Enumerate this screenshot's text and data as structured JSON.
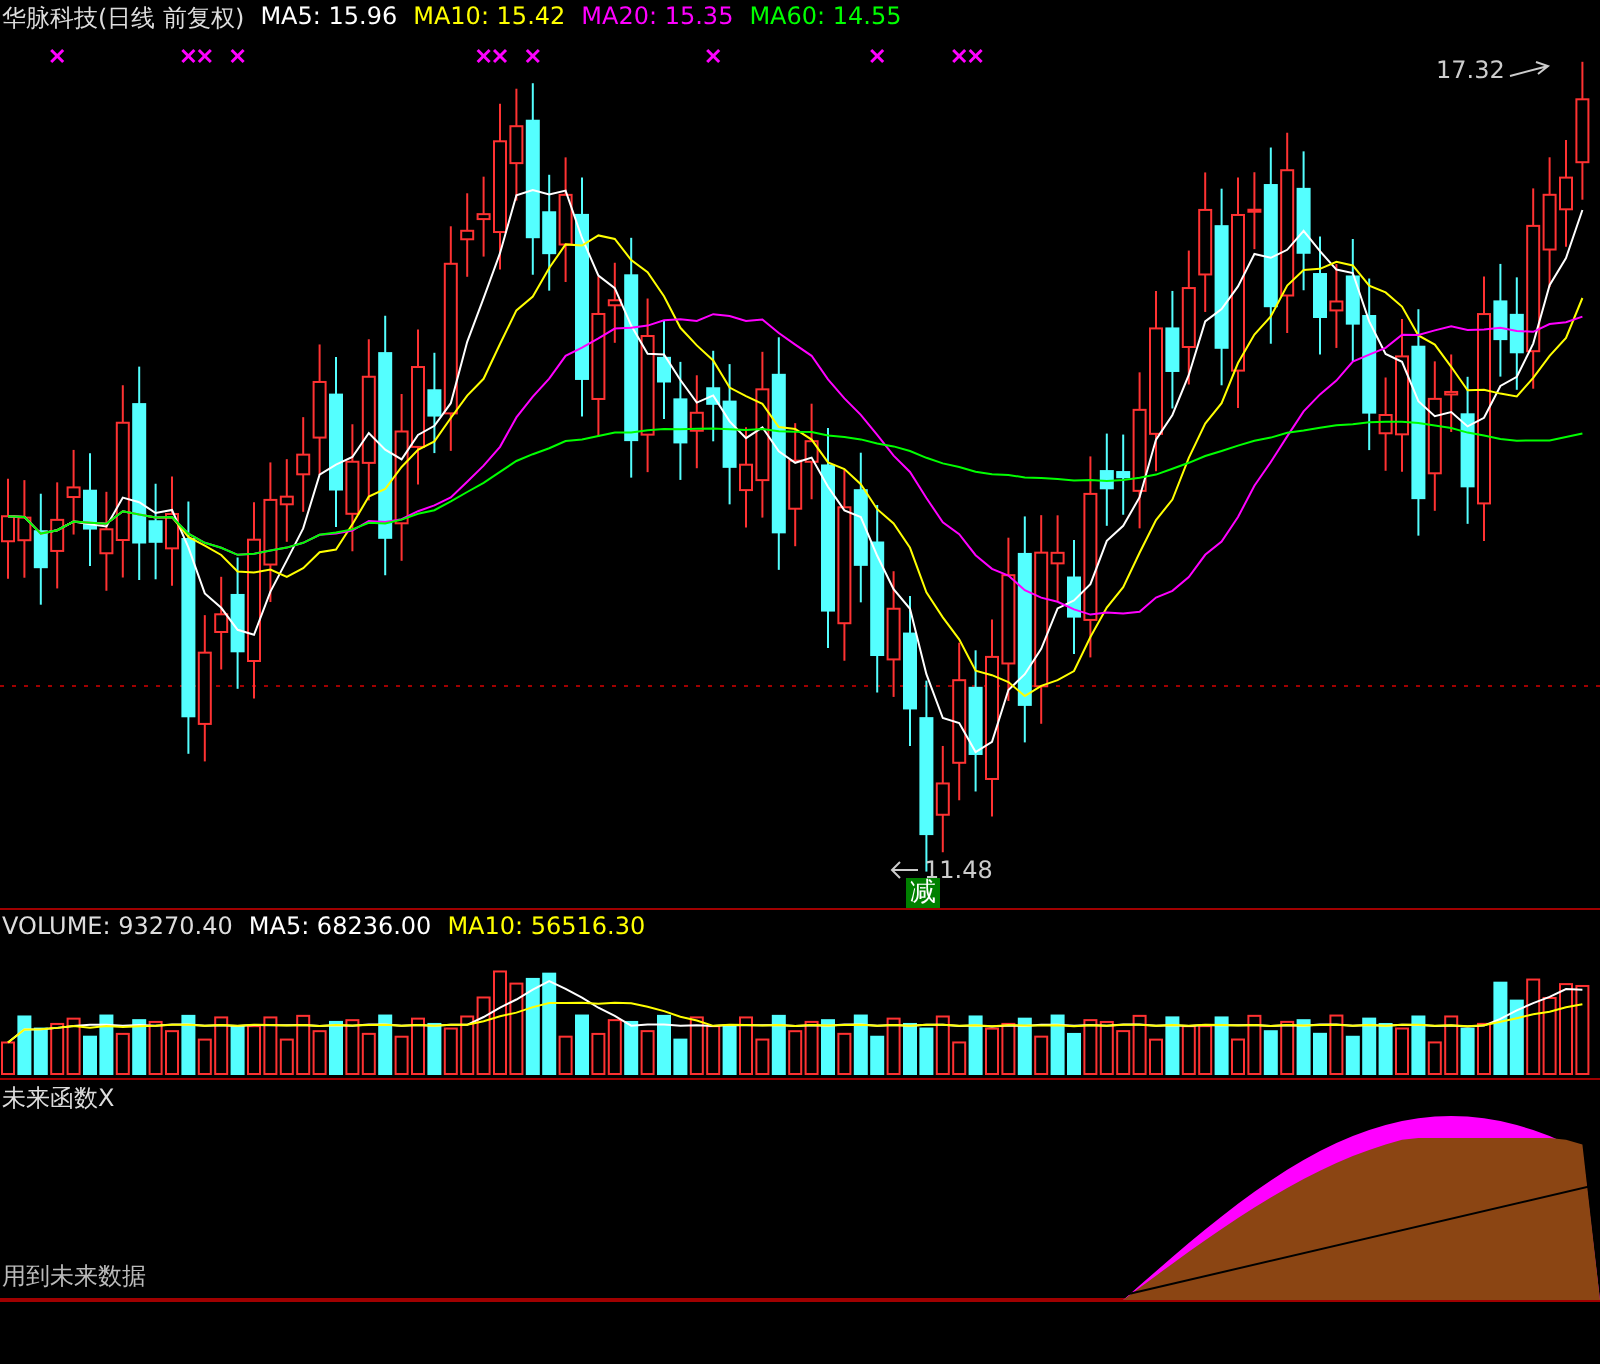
{
  "main": {
    "title": "华脉科技(日线 前复权)",
    "indicators": [
      {
        "label": "MA5:",
        "value": "15.96",
        "color": "#ffffff"
      },
      {
        "label": "MA10:",
        "value": "15.42",
        "color": "#ffff00"
      },
      {
        "label": "MA20:",
        "value": "15.35",
        "color": "#ff00ff"
      },
      {
        "label": "MA60:",
        "value": "14.55",
        "color": "#00ff00"
      }
    ],
    "high_label": "17.32",
    "low_label": "11.48",
    "signal_badge": "减"
  },
  "volume": {
    "title": "VOLUME:",
    "value": "93270.40",
    "indicators": [
      {
        "label": "MA5:",
        "value": "68236.00",
        "color": "#ffffff"
      },
      {
        "label": "MA10:",
        "value": "56516.30",
        "color": "#ffff00"
      }
    ]
  },
  "indicator_panel": {
    "title": "未来函数X",
    "note": "用到未来数据"
  }
}
